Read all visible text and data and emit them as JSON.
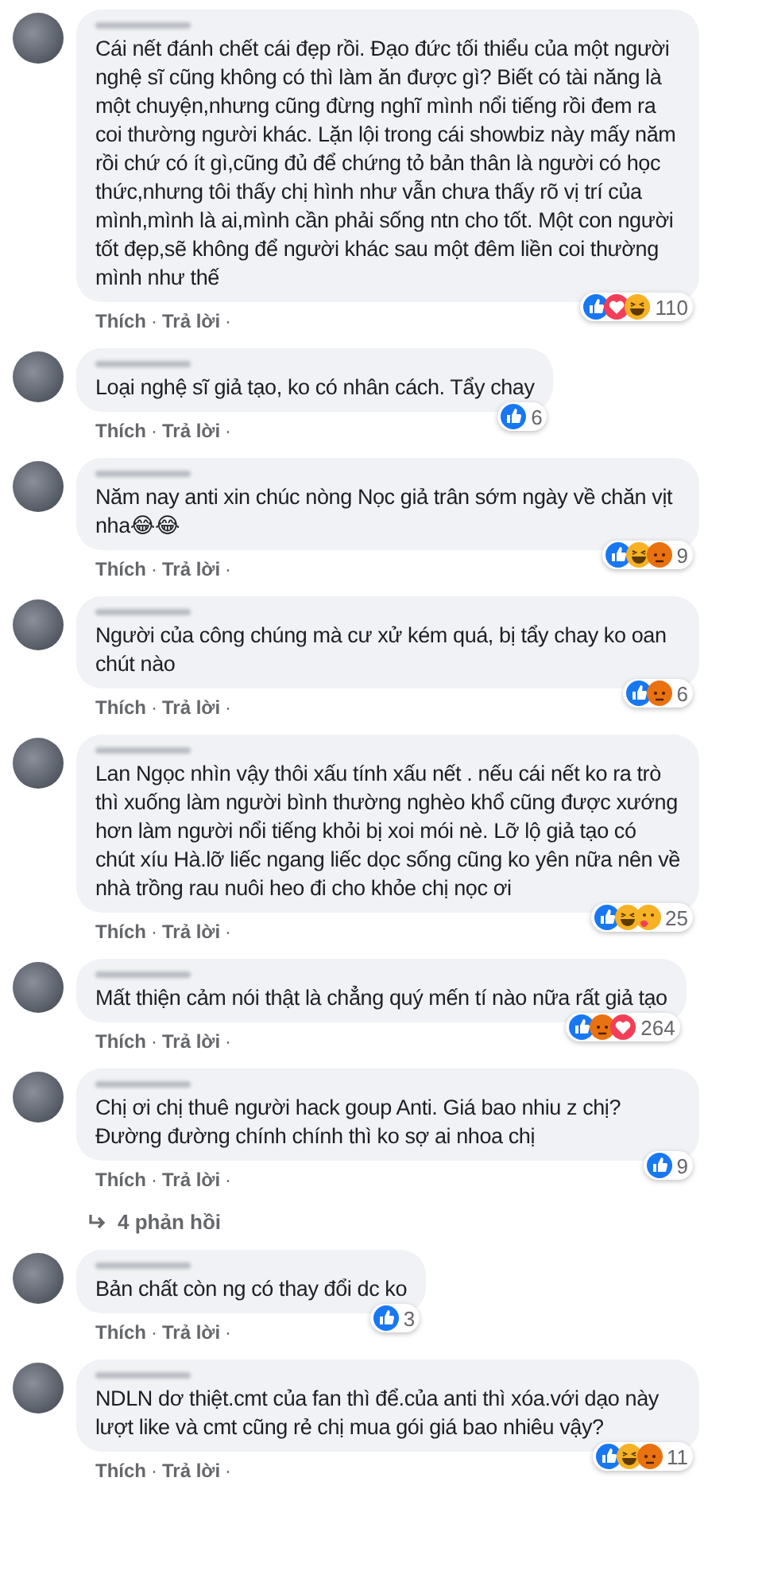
{
  "comments": [
    {
      "text": "Cái nết đánh chết cái đẹp rồi. Đạo đức tối thiểu của một người nghệ sĩ cũng không có thì làm ăn được gì? Biết có tài năng là một chuyện,nhưng cũng đừng nghĩ mình nổi tiếng rồi đem ra coi thường người khác. Lặn lội trong cái showbiz này mấy năm rồi chứ có ít gì,cũng đủ để chứng tỏ bản thân là người có học thức,nhưng tôi thấy chị hình như vẫn chưa thấy rõ vị trí của mình,mình là ai,mình cần phải sống ntn cho tốt. Một con người tốt đẹp,sẽ không để người khác sau một đêm liền coi thường mình như thế",
      "reactions": [
        {
          "kind": "like"
        },
        {
          "kind": "love"
        },
        {
          "kind": "haha"
        }
      ],
      "count": "110",
      "actions": [
        {
          "kind": "link",
          "text": "Thích"
        },
        {
          "kind": "dot",
          "text": "·"
        },
        {
          "kind": "link",
          "text": "Trả lời"
        },
        {
          "kind": "dot",
          "text": "·"
        }
      ]
    },
    {
      "text": "Loại nghệ sĩ giả tạo, ko có nhân cách. Tẩy chay",
      "reactions": [
        {
          "kind": "like"
        }
      ],
      "count": "6",
      "actions": [
        {
          "kind": "link",
          "text": "Thích"
        },
        {
          "kind": "dot",
          "text": "·"
        },
        {
          "kind": "link",
          "text": "Trả lời"
        },
        {
          "kind": "dot",
          "text": "·"
        }
      ]
    },
    {
      "text": "Năm nay anti xin chúc nòng Nọc giả trân sớm ngày về chăn vịt nha😂😂",
      "reactions": [
        {
          "kind": "like"
        },
        {
          "kind": "haha"
        },
        {
          "kind": "angry"
        }
      ],
      "count": "9",
      "actions": [
        {
          "kind": "link",
          "text": "Thích"
        },
        {
          "kind": "dot",
          "text": "·"
        },
        {
          "kind": "link",
          "text": "Trả lời"
        },
        {
          "kind": "dot",
          "text": "·"
        }
      ]
    },
    {
      "text": "Người của công chúng mà cư xử kém quá, bị tẩy chay ko oan chút nào",
      "reactions": [
        {
          "kind": "like"
        },
        {
          "kind": "angry"
        }
      ],
      "count": "6",
      "actions": [
        {
          "kind": "link",
          "text": "Thích"
        },
        {
          "kind": "dot",
          "text": "·"
        },
        {
          "kind": "link",
          "text": "Trả lời"
        },
        {
          "kind": "dot",
          "text": "·"
        }
      ]
    },
    {
      "text": "Lan Ngọc nhìn vậy thôi xấu tính xấu nết . nếu cái nết ko ra trò thì xuống làm người bình thường nghèo khổ cũng được xướng hơn làm người nổi tiếng khỏi bị xoi mói nè. Lỡ lộ giả tạo có chút xíu Hà.lỡ liếc ngang liếc dọc sống cũng ko yên nữa nên về nhà trồng rau nuôi heo đi cho khỏe chị nọc ơi",
      "reactions": [
        {
          "kind": "like"
        },
        {
          "kind": "haha"
        },
        {
          "kind": "care"
        }
      ],
      "count": "25",
      "actions": [
        {
          "kind": "link",
          "text": "Thích"
        },
        {
          "kind": "dot",
          "text": "·"
        },
        {
          "kind": "link",
          "text": "Trả lời"
        },
        {
          "kind": "dot",
          "text": "·"
        }
      ]
    },
    {
      "text": "Mất thiện cảm nói thật là chẳng quý mến tí nào nữa rất giả tạo",
      "reactions": [
        {
          "kind": "like"
        },
        {
          "kind": "angry"
        },
        {
          "kind": "love"
        }
      ],
      "count": "264",
      "actions": [
        {
          "kind": "link",
          "text": "Thích"
        },
        {
          "kind": "dot",
          "text": "·"
        },
        {
          "kind": "link",
          "text": "Trả lời"
        },
        {
          "kind": "dot",
          "text": "·"
        }
      ]
    },
    {
      "text": "Chị ơi chị thuê người hack goup Anti. Giá bao nhiu z chị? Đường đường chính chính thì ko sợ ai nhoa chị",
      "reactions": [
        {
          "kind": "like"
        }
      ],
      "count": "9",
      "actions": [
        {
          "kind": "link",
          "text": "Thích"
        },
        {
          "kind": "dot",
          "text": "·"
        },
        {
          "kind": "link",
          "text": "Trả lời"
        },
        {
          "kind": "dot",
          "text": "·"
        }
      ],
      "replies": "4 phản hồi"
    },
    {
      "text": "Bản chất còn ng có thay đổi dc ko",
      "reactions": [
        {
          "kind": "like"
        }
      ],
      "count": "3",
      "actions": [
        {
          "kind": "link",
          "text": "Thích"
        },
        {
          "kind": "dot",
          "text": "·"
        },
        {
          "kind": "link",
          "text": "Trả lời"
        },
        {
          "kind": "dot",
          "text": "·"
        }
      ]
    },
    {
      "text": "NDLN dơ thiệt.cmt của fan thì để.của anti thì xóa.với dạo này lượt like và cmt cũng rẻ chị mua gói giá bao nhiêu vậy?",
      "reactions": [
        {
          "kind": "like"
        },
        {
          "kind": "haha"
        },
        {
          "kind": "angry"
        }
      ],
      "count": "11",
      "actions": [
        {
          "kind": "link",
          "text": "Thích"
        },
        {
          "kind": "dot",
          "text": "·"
        },
        {
          "kind": "link",
          "text": "Trả lời"
        },
        {
          "kind": "dot",
          "text": "·"
        }
      ]
    }
  ]
}
